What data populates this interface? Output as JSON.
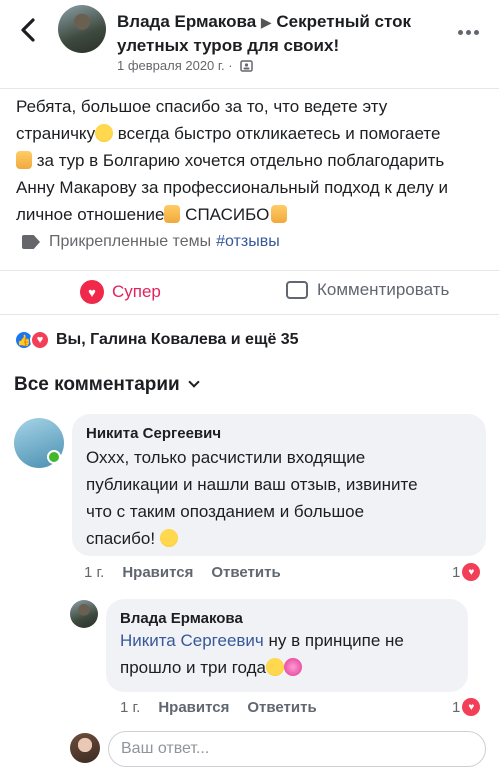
{
  "header": {
    "author": "Влада Ермакова",
    "arrow": "▶",
    "group": "Секретный сток улетных туров для своих!",
    "date": "1 февраля 2020 г. ·"
  },
  "post": {
    "line1": "Ребята, большое спасибо за то, что ведете эту",
    "line2a": "страничку",
    "line2b": " всегда быстро откликаетесь и помогаете",
    "line3": " за тур в Болгарию хочется отдельно поблагодарить",
    "line4": "Анну Макарову за профессиональный подход к делу и",
    "line5a": "личное отношение",
    "line5b": " СПАСИБО",
    "tags_label": "Прикрепленные темы",
    "hashtag": "#отзывы"
  },
  "actions": {
    "reaction_label": "Супер",
    "comment_label": "Комментировать"
  },
  "reactions_summary": "Вы, Галина Ковалева и ещё 35",
  "comments_header": "Все комментарии",
  "comments": [
    {
      "author": "Никита Сергеевич",
      "text_l1": "Оххх, только расчистили входящие",
      "text_l2": "публикации и нашли ваш отзыв, извините",
      "text_l3": "что с таким опозданием и большое",
      "text_l4": "спасибо! ",
      "time": "1 г.",
      "like": "Нравится",
      "reply": "Ответить",
      "count": "1"
    },
    {
      "author": "Влада Ермакова",
      "mention": "Никита Сергеевич",
      "text_l1": " ну в принципе не",
      "text_l2": "прошло и три года",
      "time": "1 г.",
      "like": "Нравится",
      "reply": "Ответить",
      "count": "1"
    }
  ],
  "reply_box": {
    "placeholder": "Ваш ответ..."
  },
  "colors": {
    "link": "#385898",
    "super": "#e0245e",
    "like_blue": "#1877f2"
  }
}
